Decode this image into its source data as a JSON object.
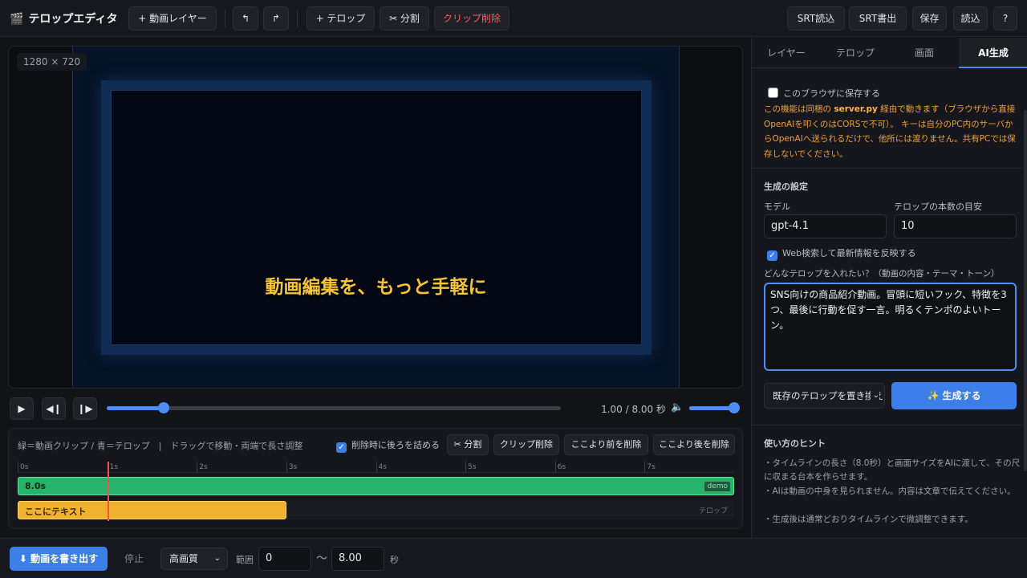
{
  "app": {
    "icon": "clapper-icon",
    "title": "テロップエディタ"
  },
  "toolbar": {
    "add_video_layer": "+ 動画レイヤー",
    "undo": "↰",
    "redo": "↱",
    "add_telop": "+ テロップ",
    "split": "✂ 分割",
    "delete_clip": "クリップ削除",
    "srt_import": "SRT読込",
    "srt_export": "SRT書出",
    "save": "保存",
    "load": "読込",
    "help": "?"
  },
  "preview": {
    "resolution": "1280 × 720",
    "telop_text": "動画編集を、もっと手軽に"
  },
  "transport": {
    "play": "▶",
    "prev": "◀❙",
    "next": "❙▶",
    "time": "1.00 / 8.00 秒",
    "progress": 0.125,
    "volume_icon": "speaker-icon",
    "volume_glyph": "🔈",
    "volume": 1.0
  },
  "timeline": {
    "hint": "緑＝動画クリップ / 青＝テロップ　|　ドラッグで移動・両端で長さ調整",
    "ripple_delete": {
      "label": "削除時に後ろを詰める",
      "checked": true
    },
    "split": "✂ 分割",
    "delete_clip": "クリップ削除",
    "delete_before": "ここより前を削除",
    "delete_after": "ここより後を削除",
    "ticks": [
      "0s",
      "1s",
      "2s",
      "3s",
      "4s",
      "5s",
      "6s",
      "7s"
    ],
    "duration": 8,
    "playhead": 1,
    "video_clip": {
      "label": "8.0s",
      "tag": "demo",
      "start": 0,
      "end": 8
    },
    "telop_clip": {
      "label": "ここにテキスト",
      "start": 0,
      "end": 3
    },
    "telop_track_tag": "テロップ"
  },
  "export": {
    "button": "⬇ 動画を書き出す",
    "stop": "停止",
    "quality": "高画質",
    "range_label": "範囲",
    "range_from": "0",
    "range_sep": "〜",
    "range_to": "8.00",
    "unit": "秒"
  },
  "panel": {
    "tabs": [
      "レイヤー",
      "テロップ",
      "画面",
      "AI生成"
    ],
    "active_tab": 3,
    "save_in_browser": {
      "label": "このブラウザに保存する",
      "checked": false
    },
    "warning_pre": "この機能は同梱の ",
    "warning_file": "server.py",
    "warning_post": " 経由で動きます（ブラウザから直接OpenAIを叩くのはCORSで不可）。 キーは自分のPC内のサーバからOpenAIへ送られるだけで、他所には渡りません。共有PCでは保存しないでください。",
    "gen_settings_title": "生成の設定",
    "model_label": "モデル",
    "model_value": "gpt-4.1",
    "count_label": "テロップの本数の目安",
    "count_value": "10",
    "web_search": {
      "label": "Web検索して最新情報を反映する",
      "checked": true
    },
    "prompt_label": "どんなテロップを入れたい？（動画の内容・テーマ・トーン）",
    "prompt_value": "SNS向けの商品紹介動画。冒頭に短いフック、特徴を3つ、最後に行動を促す一言。明るくテンポのよいトーン。",
    "mode_select": "既存のテロップを置き換え",
    "generate": "✨ 生成する",
    "hints_title": "使い方のヒント",
    "hints": [
      "・タイムラインの長さ（8.0秒）と画面サイズをAIに渡して、その尺に収まる台本を作らせます。",
      "・AIは動画の中身を見られません。内容は文章で伝えてください。",
      "・生成後は通常どおりタイムラインで微調整できます。"
    ]
  }
}
